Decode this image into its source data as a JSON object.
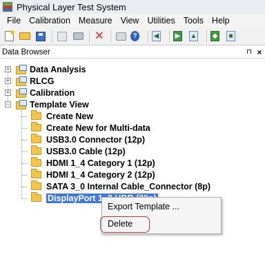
{
  "window": {
    "title": "Physical Layer Test System"
  },
  "menubar": {
    "items": [
      "File",
      "Calibration",
      "Measure",
      "View",
      "Utilities",
      "Tools",
      "Help"
    ]
  },
  "toolbar": {
    "icons": [
      "new-document-icon",
      "open-folder-icon",
      "save-icon",
      "copy-icon",
      "camera-icon",
      "delete-icon",
      "print-icon",
      "help-icon",
      "back-icon",
      "forward-icon",
      "import-icon",
      "export-icon"
    ]
  },
  "panel": {
    "title": "Data Browser",
    "pin_glyph": "⊓",
    "close_glyph": "×"
  },
  "tree": {
    "roots": [
      {
        "label": "Data Analysis",
        "expander": "+"
      },
      {
        "label": "RLCG",
        "expander": "+"
      },
      {
        "label": "Calibration",
        "expander": "+"
      },
      {
        "label": "Template View",
        "expander": "−"
      }
    ],
    "template_children": [
      "Create New",
      "Create New for Multi-data",
      "USB3.0 Connector (12p)",
      "USB3.0 Cable (12p)",
      "HDMI 1_4 Category 1 (12p)",
      "HDMI 1_4 Category 2 (12p)",
      "SATA 3_0 Internal Cable_Connector (8p)",
      "DisplayPort 1_2 HBR (20p)"
    ],
    "selected_item": "DisplayPort 1_2 HBR (20p)"
  },
  "context_menu": {
    "items": [
      "Export Template ...",
      "Delete"
    ],
    "highlighted": "Delete"
  },
  "colors": {
    "selection": "#3d78d8",
    "highlight_ring": "#cc3333",
    "folder": "#f3c44b"
  }
}
